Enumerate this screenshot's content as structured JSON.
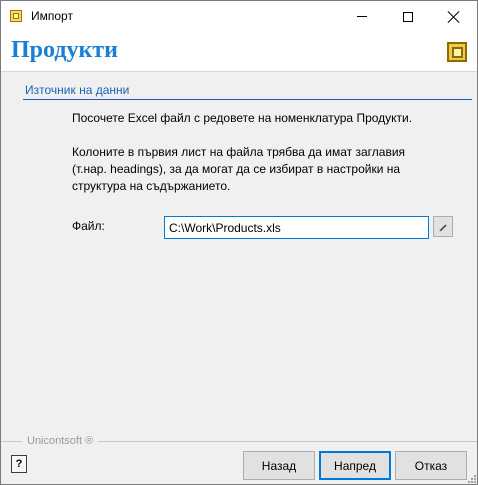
{
  "window": {
    "title": "Импорт"
  },
  "header": {
    "title": "Продукти"
  },
  "section": {
    "title": "Източник на данни"
  },
  "content": {
    "paragraph1": "Посочете Excel файл с редовете на номенклатура Продукти.",
    "paragraph2": "Колоните в първия лист на файла трябва да имат заглавия (т.нар. headings), за да могат да се избират в настройки на структура на съдържанието."
  },
  "file": {
    "label": "Файл:",
    "value": "C:\\Work\\Products.xls"
  },
  "footer": {
    "brand": "Unicontsoft ®",
    "help_label": "?",
    "back_label": "Назад",
    "next_label": "Напред",
    "cancel_label": "Отказ"
  },
  "colors": {
    "accent": "#1a7fd6",
    "section": "#1f5fb4",
    "focus": "#0078d7"
  }
}
